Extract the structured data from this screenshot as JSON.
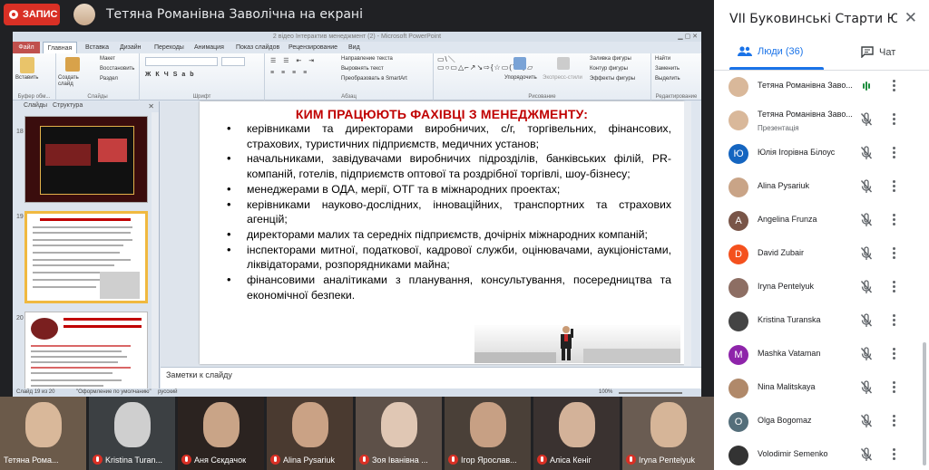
{
  "meet": {
    "record_label": "ЗАПИС",
    "presenter_title": "Тетяна Романівна Заволічна на екрані",
    "colors": {
      "accent": "#1a73e8",
      "record": "#d93025",
      "dark_bg": "#202124"
    }
  },
  "ppt": {
    "window_title": "2 відео Інтерактив менеджмент (2) - Microsoft PowerPoint",
    "tabs": [
      "Файл",
      "Главная",
      "Вставка",
      "Дизайн",
      "Переходы",
      "Анимация",
      "Показ слайдов",
      "Рецензирование",
      "Вид"
    ],
    "groups": {
      "clipboard": "Буфер обм...",
      "slides": "Слайды",
      "font": "Шрифт",
      "paragraph": "Абзац",
      "drawing": "Рисование",
      "editing": "Редактирование"
    },
    "buttons": {
      "paste": "Вставить",
      "create_slide": "Создать слайд",
      "layout": "Макет",
      "reset": "Восстановить",
      "section": "Раздел",
      "text_direction": "Направление текста",
      "align_text": "Выровнять текст",
      "smartart": "Преобразовать в SmartArt",
      "arrange": "Упорядочить",
      "quick_styles": "Экспресс-стили",
      "shape_fill": "Заливка фигуры",
      "shape_outline": "Контур фигуры",
      "shape_effects": "Эффекты фигуры",
      "find": "Найти",
      "replace": "Заменить",
      "select": "Выделить"
    },
    "panel_tabs": [
      "Слайды",
      "Структура"
    ],
    "slide_numbers": [
      "18",
      "19",
      "20"
    ],
    "slide": {
      "title": "КИМ ПРАЦЮЮТЬ ФАХІВЦІ З МЕНЕДЖМЕНТУ:",
      "bullets": [
        "керівниками та директорами виробничих, с/г, торгівельних, фінансових, страхових, туристичних підприємств, медичних установ;",
        "начальниками, завідувачами виробничих підрозділів, банківських філій, PR-компаній, готелів, підприємств оптової та роздрібної торгівлі, шоу-бізнесу;",
        "менеджерами в ОДА, мерії, ОТГ та в міжнародних проектах;",
        "керівниками науково-дослідних, інноваційних, транспортних та страхових агенцій;",
        "директорами малих та середніх підприємств, дочірніх міжнародних компаній;",
        "інспекторами митної, податкової, кадрової служби, оцінювачами, аукціоністами, ліквідаторами, розпорядниками майна;",
        "фінансовими аналітиками з планування, консультування, посередництва та економічної безпеки."
      ]
    },
    "notes_placeholder": "Заметки к слайду",
    "status": {
      "slide_of": "Слайд 19 из 20",
      "theme": "\"Оформление по умолчанию\"",
      "lang": "русский",
      "zoom": "100%"
    }
  },
  "tiles": [
    {
      "name": "Тетяна Рома...",
      "muted": false,
      "bg": "#6b5a4a",
      "face": "#d9b89a"
    },
    {
      "name": "Kristina Turan...",
      "muted": true,
      "bg": "#3c4043",
      "face": "#cfcfcf"
    },
    {
      "name": "Аня Сєкдачок",
      "muted": true,
      "bg": "#2b2320",
      "face": "#c9a487"
    },
    {
      "name": "Alina Pysariuk",
      "muted": true,
      "bg": "#4a3a30",
      "face": "#caa285"
    },
    {
      "name": "Зоя Іванівна ...",
      "muted": true,
      "bg": "#5d5048",
      "face": "#e0c7b4"
    },
    {
      "name": "Ігор Ярослав...",
      "muted": true,
      "bg": "#4a4038",
      "face": "#c7a084"
    },
    {
      "name": "Аліса Кеніг",
      "muted": true,
      "bg": "#3a3230",
      "face": "#d3b299"
    },
    {
      "name": "Iryna Pentelyuk",
      "muted": true,
      "bg": "#6a5c52",
      "face": "#d6b598"
    }
  ],
  "side": {
    "title": "VII Буковинські Старти Юних Ек...",
    "people_tab": "Люди (36)",
    "chat_tab": "Чат",
    "people": [
      {
        "name": "Тетяна Романівна Заво...",
        "sub": "",
        "initial": "",
        "color": "#d9b89a",
        "mic": "on"
      },
      {
        "name": "Тетяна Романівна Заво...",
        "sub": "Презентація",
        "initial": "",
        "color": "#d9b89a",
        "mic": "off"
      },
      {
        "name": "Юлія Ігорівна Білоус",
        "sub": "",
        "initial": "Ю",
        "color": "#1565c0",
        "mic": "off"
      },
      {
        "name": "Alina Pysariuk",
        "sub": "",
        "initial": "",
        "color": "#c9a487",
        "mic": "off"
      },
      {
        "name": "Angelina Frunza",
        "sub": "",
        "initial": "A",
        "color": "#795548",
        "mic": "off"
      },
      {
        "name": "David Zubair",
        "sub": "",
        "initial": "D",
        "color": "#f4511e",
        "mic": "off"
      },
      {
        "name": "Iryna Pentelyuk",
        "sub": "",
        "initial": "",
        "color": "#8d6e63",
        "mic": "off"
      },
      {
        "name": "Kristina Turanska",
        "sub": "",
        "initial": "",
        "color": "#444",
        "mic": "off"
      },
      {
        "name": "Mashka Vatаman",
        "sub": "",
        "initial": "M",
        "color": "#8e24aa",
        "mic": "off"
      },
      {
        "name": "Nina Malitskaya",
        "sub": "",
        "initial": "",
        "color": "#b0896a",
        "mic": "off"
      },
      {
        "name": "Olga Bogomaz",
        "sub": "",
        "initial": "O",
        "color": "#546e7a",
        "mic": "off"
      },
      {
        "name": "Volodimir Semenko",
        "sub": "",
        "initial": "",
        "color": "#333",
        "mic": "off"
      }
    ]
  }
}
